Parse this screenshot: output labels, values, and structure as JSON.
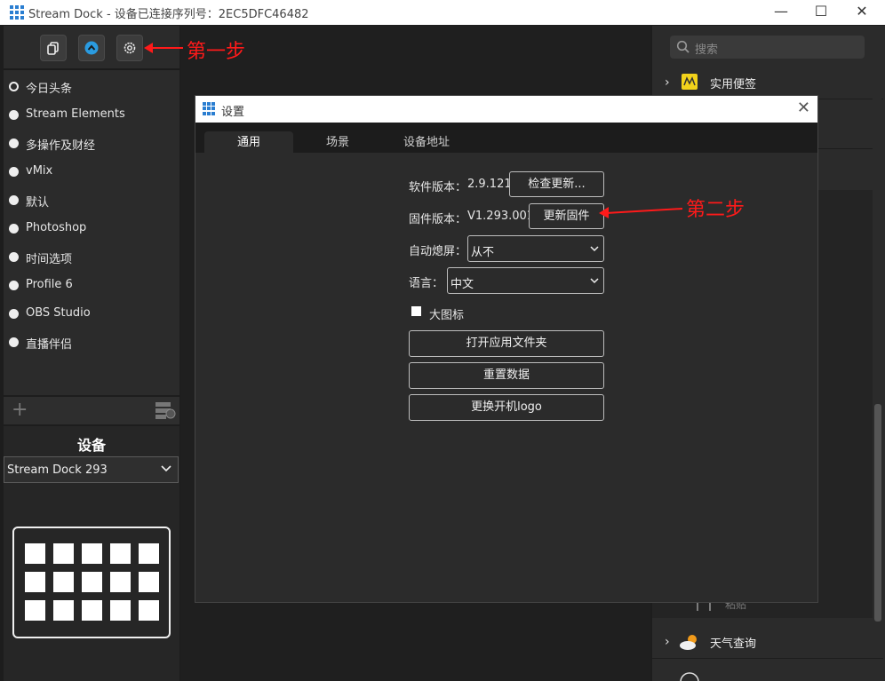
{
  "window": {
    "title": "Stream Dock - 设备已连接序列号：2EC5DFC46482"
  },
  "profiles": [
    {
      "label": "今日头条",
      "selected": true
    },
    {
      "label": "Stream Elements"
    },
    {
      "label": "多操作及财经"
    },
    {
      "label": "vMix"
    },
    {
      "label": "默认"
    },
    {
      "label": "Photoshop"
    },
    {
      "label": "时间选项"
    },
    {
      "label": "Profile 6"
    },
    {
      "label": "OBS  Studio"
    },
    {
      "label": "直播伴侣"
    }
  ],
  "device": {
    "heading": "设备",
    "selected": "Stream Dock 293",
    "key_rows": 3,
    "key_cols": 5
  },
  "right": {
    "search_placeholder": "搜索",
    "categories": [
      "实用便签",
      "天气查询"
    ],
    "faded_item": "粘贴"
  },
  "dialog": {
    "title": "设置",
    "tabs": [
      "通用",
      "场景",
      "设备地址"
    ],
    "software_label": "软件版本：",
    "software_version": "2.9.121",
    "check_update": "检查更新...",
    "firmware_label": "固件版本：",
    "firmware_version": "V1.293.001",
    "update_firmware": "更新固件",
    "auto_sleep_label": "自动熄屏：",
    "auto_sleep_value": "从不",
    "language_label": "语言：",
    "language_value": "中文",
    "large_icons": "大图标",
    "open_folder": "打开应用文件夹",
    "reset_data": "重置数据",
    "change_logo": "更换开机logo"
  },
  "annotations": {
    "step1": "第一步",
    "step2": "第二步"
  },
  "colors": {
    "accent": "#2a7ed1",
    "annotation": "#ff1a1a"
  }
}
